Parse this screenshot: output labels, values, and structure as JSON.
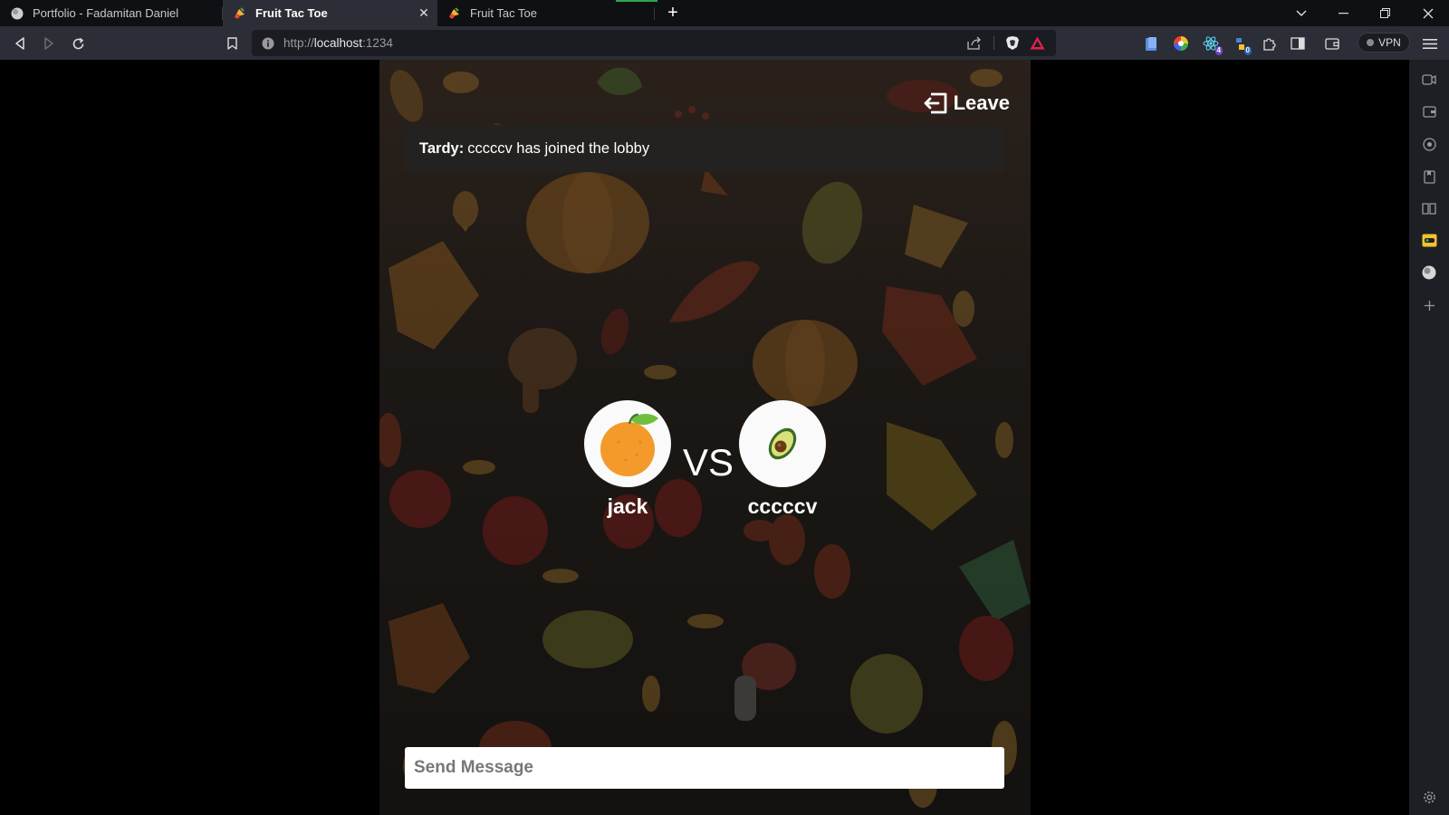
{
  "browser": {
    "tabs": [
      {
        "title": "Portfolio - Fadamitan Daniel",
        "active": false
      },
      {
        "title": "Fruit Tac Toe",
        "active": true
      },
      {
        "title": "Fruit Tac Toe",
        "active": false
      }
    ],
    "url": {
      "scheme": "http://",
      "host": "localhost",
      "port": ":1234"
    },
    "extension_badges": {
      "ext1": "4",
      "ext2": "0"
    },
    "vpn_label": "VPN",
    "accent_color": "#2b2e36"
  },
  "game": {
    "leave_label": "Leave",
    "notice": {
      "sender": "Tardy:",
      "text": "cccccv has joined the lobby"
    },
    "players": [
      {
        "name": "jack",
        "fruit": "orange-icon"
      },
      {
        "name": "cccccv",
        "fruit": "avocado-icon"
      }
    ],
    "vs_label": "VS",
    "message_placeholder": "Send Message"
  }
}
